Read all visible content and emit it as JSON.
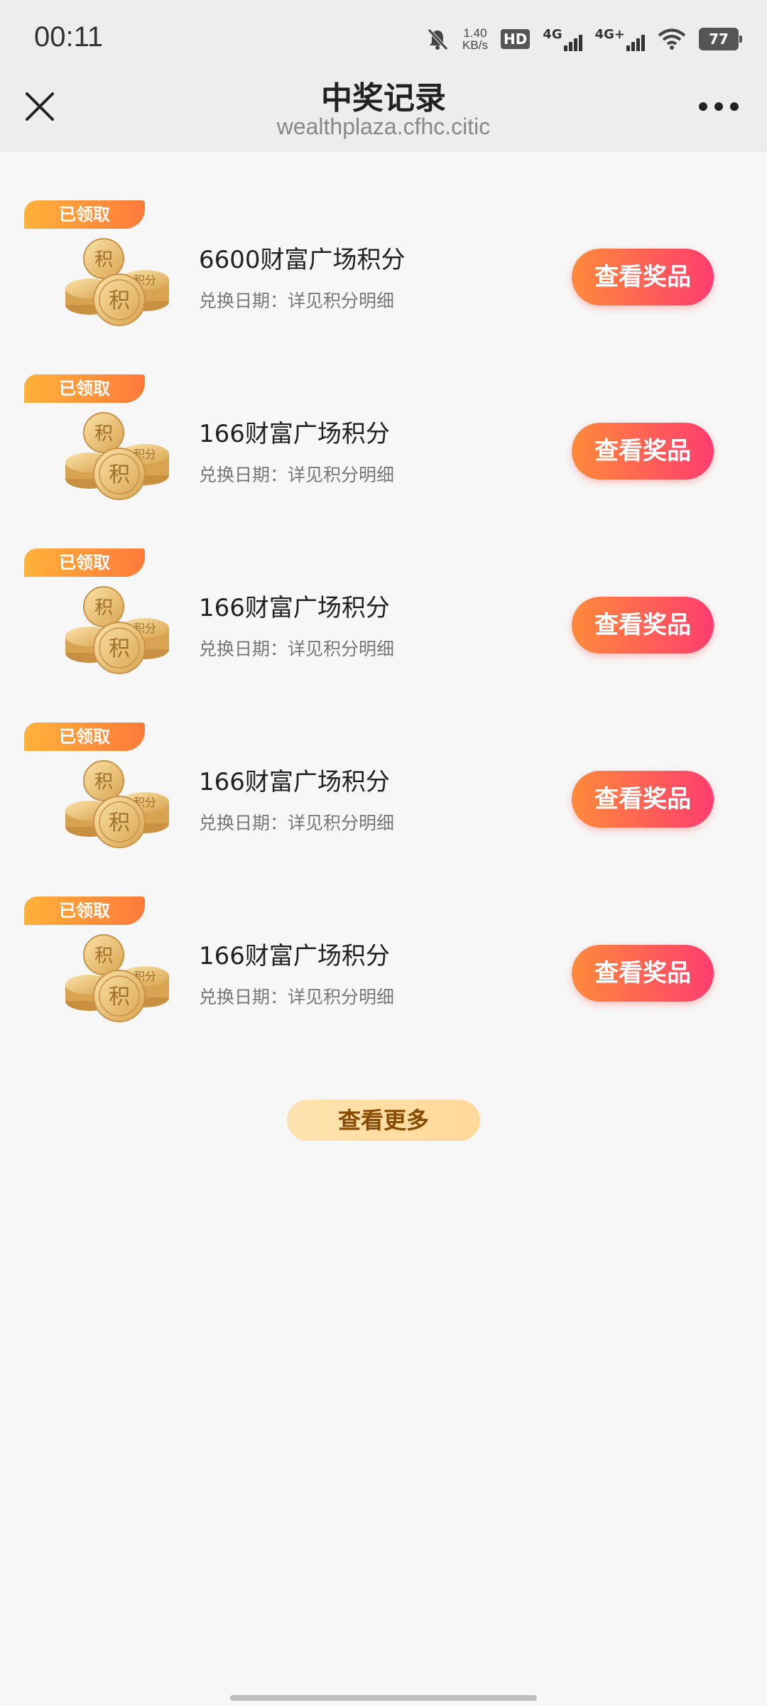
{
  "status_bar": {
    "time": "00:11",
    "speed_value": "1.40",
    "speed_unit": "KB/s",
    "hd": "HD",
    "sim1": "4G",
    "sim2": "4G+",
    "battery": "77"
  },
  "header": {
    "title": "中奖记录",
    "url": "wealthplaza.cfhc.citic"
  },
  "records": [
    {
      "badge": "已领取",
      "title": "6600财富广场积分",
      "subtitle": "兑换日期：详见积分明细",
      "button": "查看奖品"
    },
    {
      "badge": "已领取",
      "title": "166财富广场积分",
      "subtitle": "兑换日期：详见积分明细",
      "button": "查看奖品"
    },
    {
      "badge": "已领取",
      "title": "166财富广场积分",
      "subtitle": "兑换日期：详见积分明细",
      "button": "查看奖品"
    },
    {
      "badge": "已领取",
      "title": "166财富广场积分",
      "subtitle": "兑换日期：详见积分明细",
      "button": "查看奖品"
    },
    {
      "badge": "已领取",
      "title": "166财富广场积分",
      "subtitle": "兑换日期：详见积分明细",
      "button": "查看奖品"
    }
  ],
  "more_button": "查看更多",
  "coin_glyphs": [
    "积",
    "分"
  ],
  "colors": {
    "badge_start": "#ffb23a",
    "badge_end": "#ff7a3a",
    "button_start": "#ff8a3a",
    "button_end": "#ff3d6e",
    "more_button_bg": "#ffdfa6",
    "more_button_text": "#8a4a00"
  }
}
